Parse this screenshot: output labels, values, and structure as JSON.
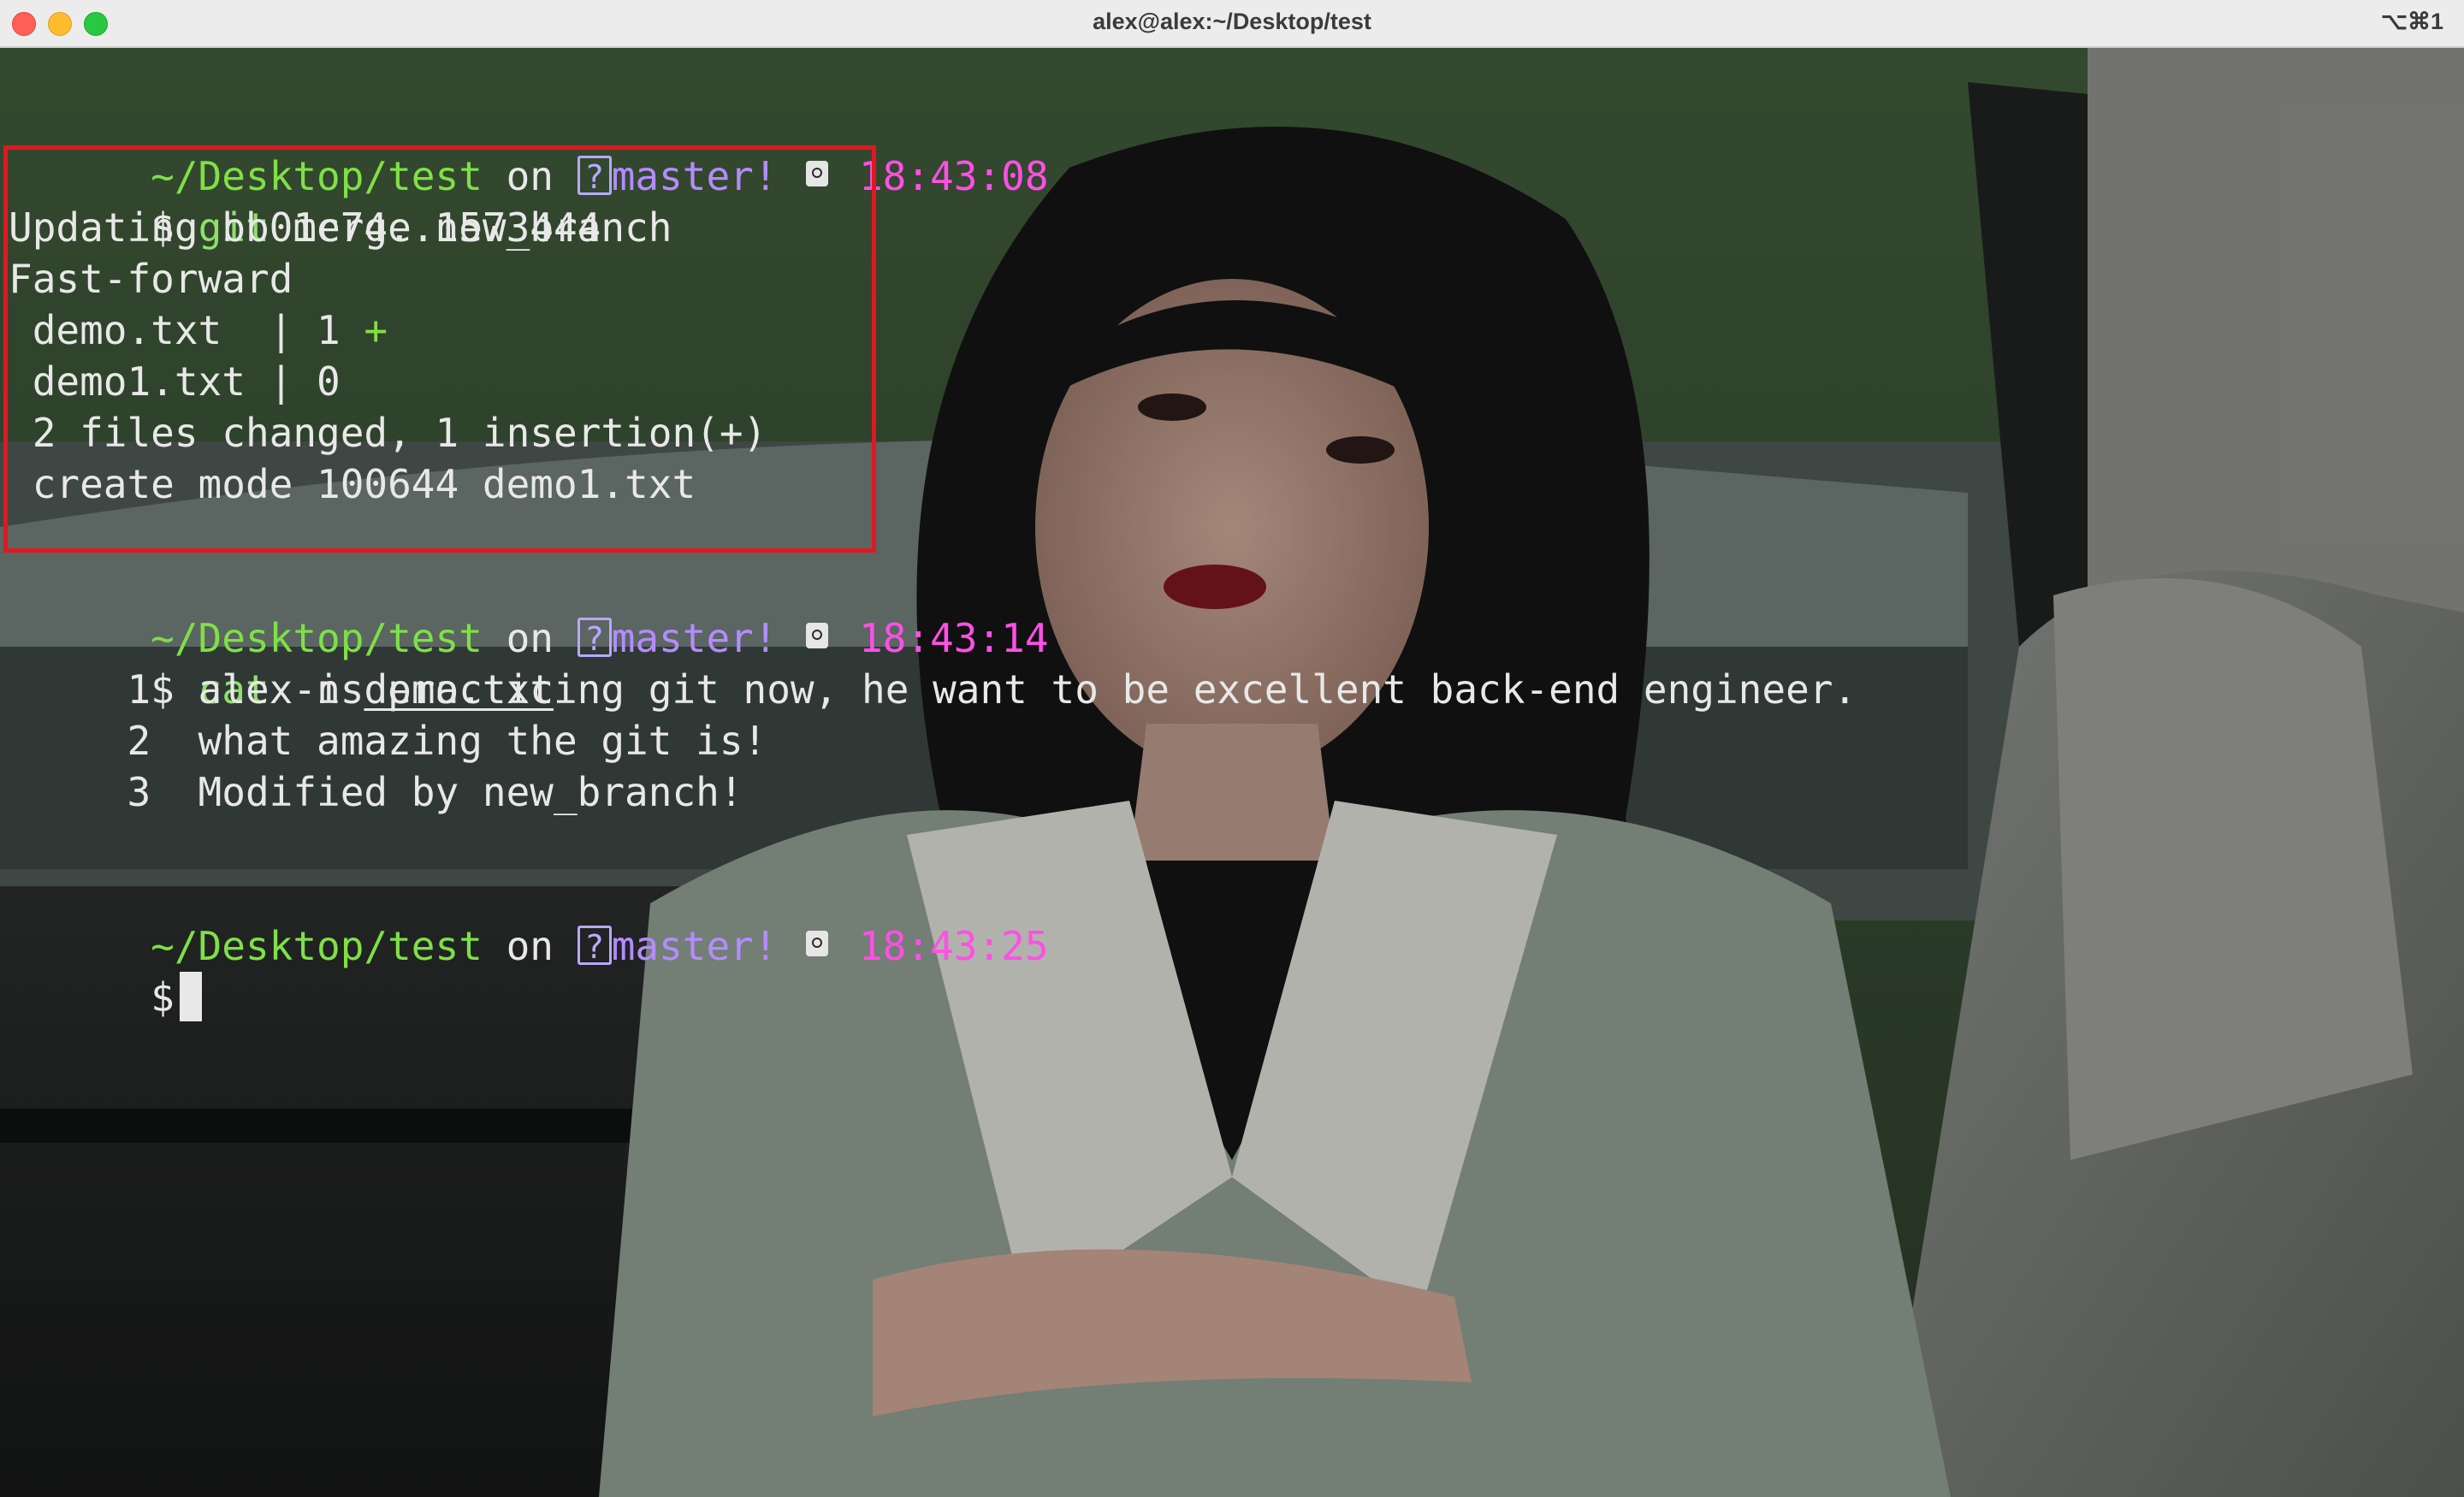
{
  "window": {
    "title": "alex@alex:~/Desktop/test",
    "shortcut": "⌥⌘1"
  },
  "terminal": {
    "prompts": [
      {
        "path": "~/Desktop/test",
        "on": "on",
        "branch_icon": "?",
        "branch": "master!",
        "time": "18:43:08"
      },
      {
        "path": "~/Desktop/test",
        "on": "on",
        "branch_icon": "?",
        "branch": "master!",
        "time": "18:43:14"
      },
      {
        "path": "~/Desktop/test",
        "on": "on",
        "branch_icon": "?",
        "branch": "master!",
        "time": "18:43:25"
      }
    ],
    "dollar": "$",
    "cmd1": {
      "name": "git",
      "args": "merge new_branch"
    },
    "merge_output": {
      "updating": "Updating bb01c74..1573444",
      "fast_forward": "Fast-forward",
      "file1": " demo.txt  | 1 ",
      "file1_plus": "+",
      "file2": " demo1.txt | 0",
      "summary": " 2 files changed, 1 insertion(+)",
      "create": " create mode 100644 demo1.txt"
    },
    "cmd2": {
      "name": "cat",
      "flag": "-n",
      "file": "demo.txt"
    },
    "cat_output": [
      "     1  alex is practicing git now, he want to be excellent back-end engineer.",
      "     2  what amazing the git is!",
      "     3  Modified by new_branch!"
    ]
  },
  "colors": {
    "path": "#7fe046",
    "branch": "#b48cff",
    "time": "#ff4fe6",
    "highlight_box": "#e01822",
    "titlebar": "#ececec"
  },
  "icons": [
    "close-icon",
    "minimize-icon",
    "maximize-icon",
    "question-box-icon",
    "clock-icon"
  ]
}
